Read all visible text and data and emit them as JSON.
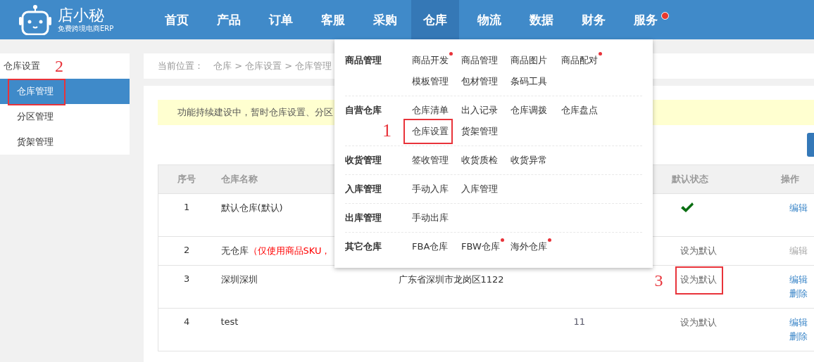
{
  "logo": {
    "name": "店小秘",
    "tagline": "免费跨境电商ERP"
  },
  "nav": [
    {
      "label": "首页",
      "selected": false,
      "dot": false
    },
    {
      "label": "产品",
      "selected": false,
      "dot": false
    },
    {
      "label": "订单",
      "selected": false,
      "dot": false
    },
    {
      "label": "客服",
      "selected": false,
      "dot": false
    },
    {
      "label": "采购",
      "selected": false,
      "dot": false
    },
    {
      "label": "仓库",
      "selected": true,
      "dot": false
    },
    {
      "label": "物流",
      "selected": false,
      "dot": false
    },
    {
      "label": "数据",
      "selected": false,
      "dot": false
    },
    {
      "label": "财务",
      "selected": false,
      "dot": false
    },
    {
      "label": "服务",
      "selected": false,
      "dot": true
    }
  ],
  "sidebar": {
    "title": "仓库设置",
    "title_callout": "2",
    "items": [
      {
        "label": "仓库管理",
        "selected": true,
        "highlighted": true
      },
      {
        "label": "分区管理",
        "selected": false,
        "highlighted": false
      },
      {
        "label": "货架管理",
        "selected": false,
        "highlighted": false
      }
    ]
  },
  "breadcrumb": {
    "prefix": "当前位置：",
    "path": "仓库 > 仓库设置 > 仓库管理"
  },
  "notice": "功能持续建设中，暂时仓库设置、分区",
  "table": {
    "columns": [
      "序号",
      "仓库名称",
      "",
      "",
      "默认状态",
      "操作"
    ],
    "rows": [
      {
        "index": "1",
        "name": "默认仓库(默认)",
        "is_default": true,
        "actions": [
          {
            "label": "编辑",
            "disabled": false
          }
        ]
      },
      {
        "index": "2",
        "name": "无仓库",
        "note": "（仅使用商品SKU，",
        "is_default": false,
        "default_label": "设为默认",
        "actions": [
          {
            "label": "编辑",
            "disabled": true
          }
        ]
      },
      {
        "index": "3",
        "name": "深圳深圳",
        "address": "广东省深圳市龙岗区1122",
        "is_default": false,
        "default_label": "设为默认",
        "callout": "3",
        "actions": [
          {
            "label": "编辑",
            "disabled": false
          },
          {
            "label": "删除",
            "disabled": false
          }
        ]
      },
      {
        "index": "4",
        "name": "test",
        "column_4": "11",
        "is_default": false,
        "default_label": "设为默认",
        "actions": [
          {
            "label": "编辑",
            "disabled": false
          },
          {
            "label": "删除",
            "disabled": false
          }
        ]
      }
    ]
  },
  "dropdown": [
    {
      "title": "商品管理",
      "items": [
        {
          "label": "商品开发",
          "dot": true
        },
        {
          "label": "商品管理",
          "dot": false
        },
        {
          "label": "商品图片",
          "dot": false
        },
        {
          "label": "商品配对",
          "dot": true
        },
        {
          "label": "模板管理",
          "dot": false
        },
        {
          "label": "包材管理",
          "dot": false
        },
        {
          "label": "条码工具",
          "dot": false
        }
      ]
    },
    {
      "title": "自营仓库",
      "items": [
        {
          "label": "仓库清单",
          "dot": false
        },
        {
          "label": "出入记录",
          "dot": false
        },
        {
          "label": "仓库调拨",
          "dot": false
        },
        {
          "label": "仓库盘点",
          "dot": false
        },
        {
          "label": "仓库设置",
          "dot": false,
          "callout": "1"
        },
        {
          "label": "货架管理",
          "dot": false
        }
      ]
    },
    {
      "title": "收货管理",
      "items": [
        {
          "label": "签收管理",
          "dot": false
        },
        {
          "label": "收货质检",
          "dot": false
        },
        {
          "label": "收货异常",
          "dot": false
        }
      ]
    },
    {
      "title": "入库管理",
      "items": [
        {
          "label": "手动入库",
          "dot": false
        },
        {
          "label": "入库管理",
          "dot": false
        }
      ]
    },
    {
      "title": "出库管理",
      "items": [
        {
          "label": "手动出库",
          "dot": false
        }
      ]
    },
    {
      "title": "其它仓库",
      "items": [
        {
          "label": "FBA仓库",
          "dot": false
        },
        {
          "label": "FBW仓库",
          "dot": true
        },
        {
          "label": "海外仓库",
          "dot": true
        }
      ]
    }
  ]
}
